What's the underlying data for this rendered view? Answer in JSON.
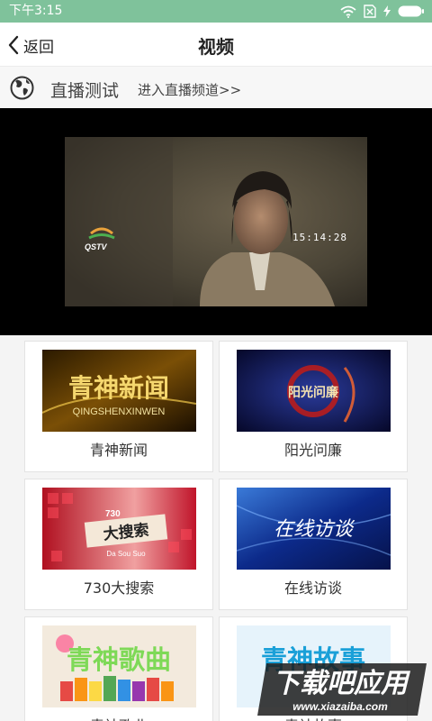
{
  "status_bar": {
    "time": "下午3:15"
  },
  "header": {
    "back_label": "返回",
    "title": "视频"
  },
  "live": {
    "title": "直播测试",
    "link": "进入直播频道>>"
  },
  "player": {
    "timestamp": "15:14:28",
    "channel_logo_text": "QSTV"
  },
  "cards": [
    {
      "label": "青神新闻",
      "thumb_text": "青神新闻",
      "thumb_subtext": "QINGSHENXINWEN"
    },
    {
      "label": "阳光问廉",
      "thumb_text": "阳光问廉"
    },
    {
      "label": "730大搜索",
      "thumb_text": "大搜索",
      "thumb_badge": "730",
      "thumb_subtext": "Da Sou Suo"
    },
    {
      "label": "在线访谈",
      "thumb_text": "在线访谈"
    },
    {
      "label": "青神歌曲",
      "thumb_text": "青神歌曲"
    },
    {
      "label": "青神故事",
      "thumb_text": "青神故事"
    }
  ],
  "watermark": {
    "text": "下载吧应用",
    "url": "www.xiazaiba.com"
  },
  "colors": {
    "status_bar": "#7fc29b",
    "accent_green": "#7fc29b"
  }
}
